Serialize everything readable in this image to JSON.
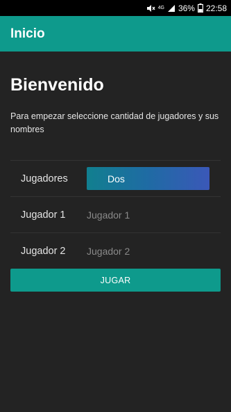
{
  "status_bar": {
    "network": "4G",
    "battery": "36%",
    "time": "22:58"
  },
  "app_bar": {
    "title": "Inicio"
  },
  "main": {
    "title": "Bienvenido",
    "description": "Para empezar seleccione cantidad de jugadores y sus nombres",
    "players_row": {
      "label": "Jugadores",
      "selected_value": "Dos"
    },
    "player1": {
      "label": "Jugador 1",
      "placeholder": "Jugador 1",
      "value": ""
    },
    "player2": {
      "label": "Jugador 2",
      "placeholder": "Jugador 2",
      "value": ""
    },
    "play_button": "JUGAR"
  },
  "colors": {
    "accent": "#0e9a8c",
    "background": "#232323",
    "select_gradient_start": "#117f8f",
    "select_gradient_end": "#3b58b8"
  },
  "icons": [
    "mute-icon",
    "signal-icon",
    "battery-icon"
  ]
}
